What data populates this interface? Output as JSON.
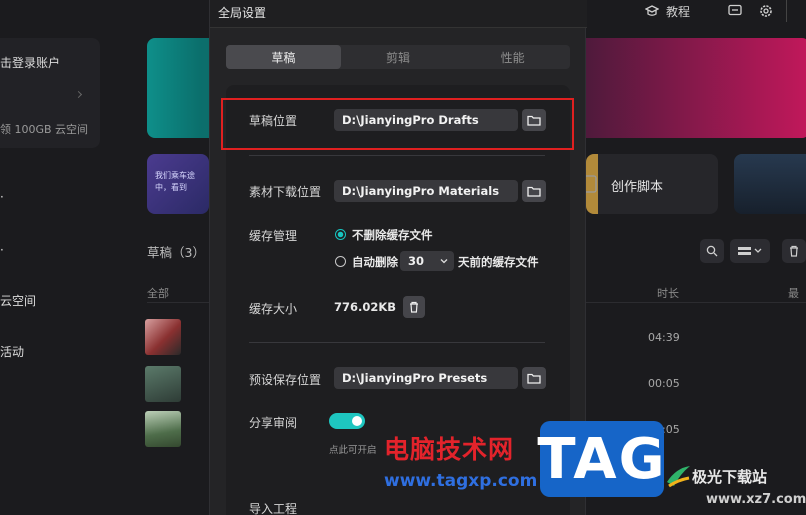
{
  "topbar": {
    "tutorial_label": "教程"
  },
  "sidebar": {
    "login_label": "击登录账户",
    "storage_label": "领 100GB 云空间",
    "cloud_label": "云空间",
    "activity_label": "活动"
  },
  "home": {
    "card_teaser_text": "我们乘车途中，看到",
    "create_script_label": "创作脚本",
    "drafts_heading": "草稿（3）",
    "col_all": "全部",
    "col_duration": "时长",
    "col_last": "最",
    "durations": [
      "04:39",
      "00:05",
      "00:05"
    ]
  },
  "modal": {
    "title": "全局设置",
    "tabs": [
      {
        "label": "草稿",
        "active": true
      },
      {
        "label": "剪辑",
        "active": false
      },
      {
        "label": "性能",
        "active": false
      }
    ],
    "draft_location": {
      "label": "草稿位置",
      "value": "D:\\JianyingPro Drafts"
    },
    "material_location": {
      "label": "素材下载位置",
      "value": "D:\\JianyingPro Materials"
    },
    "cache": {
      "label": "缓存管理",
      "option_keep": "不删除缓存文件",
      "option_auto_prefix": "自动删除",
      "days_value": "30",
      "option_auto_suffix": "天前的缓存文件"
    },
    "cache_size": {
      "label": "缓存大小",
      "value": "776.02KB"
    },
    "preset_location": {
      "label": "预设保存位置",
      "value": "D:\\JianyingPro Presets"
    },
    "share_review": {
      "label": "分享审阅",
      "hint": "点此可开启"
    },
    "import_project": {
      "label": "导入工程"
    }
  },
  "watermark": {
    "site_name": "电脑技术网",
    "site_url": "www.tagxp.com",
    "logo_text": "TAG",
    "site2_name": "极光下载站",
    "site2_url": "www.xz7.com"
  },
  "colors": {
    "accent": "#1ec6c0",
    "highlight_box": "#e02020"
  }
}
